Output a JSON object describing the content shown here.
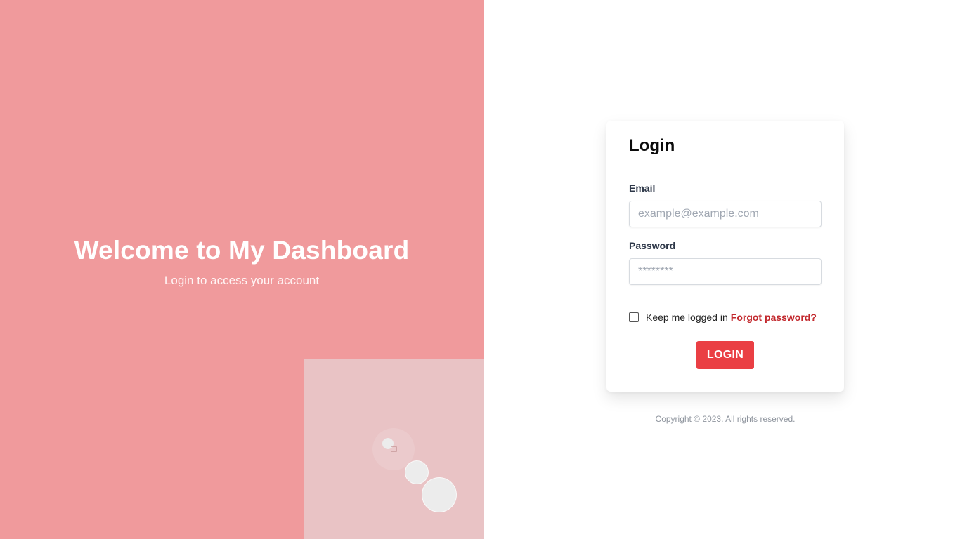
{
  "hero": {
    "title": "Welcome to My Dashboard",
    "subtitle": "Login to access your account",
    "background_color": "#f09a9c",
    "tile_color": "#e9c3c5"
  },
  "login": {
    "title": "Login",
    "email_label": "Email",
    "email_placeholder": "example@example.com",
    "email_value": "",
    "password_label": "Password",
    "password_placeholder": "********",
    "password_value": "",
    "remember_label": "Keep me logged in",
    "remember_checked": false,
    "forgot_label": "Forgot password?",
    "button_label": "LOGIN",
    "accent_color": "#ea3f44",
    "link_color": "#c2282d"
  },
  "footer": {
    "copyright": "Copyright © 2023. All rights reserved."
  }
}
